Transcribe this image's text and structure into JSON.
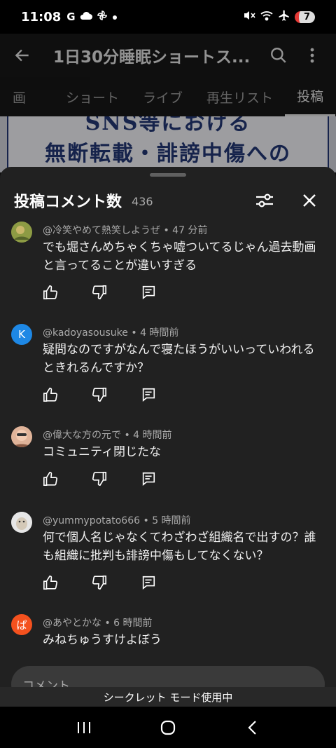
{
  "status_bar": {
    "time": "11:08",
    "left_icons": [
      "google-icon",
      "cloud-icon",
      "pinwheel-icon",
      "dot-icon"
    ],
    "right_icons": [
      "mute-icon",
      "wifi-icon",
      "airplane-icon"
    ],
    "battery": "7"
  },
  "app_bar": {
    "title": "1日30分睡眠ショートス..."
  },
  "tabs": [
    "画",
    "ショート",
    "ライブ",
    "再生リスト",
    "投稿"
  ],
  "active_tab": "投稿",
  "banner": {
    "line1": "SNS等における",
    "line2": "無断転載・誹謗中傷への"
  },
  "sheet": {
    "title": "投稿コメント数",
    "count": "436"
  },
  "comments": [
    {
      "author": "@冷笑やめて熱笑しようぜ",
      "time": "47 分前",
      "text": "でも堀さんめちゃくちゃ嘘ついてるじゃん過去動画と言ってることが違いすぎる",
      "avatar_letter": "",
      "avatar_color": "#7a8a3a"
    },
    {
      "author": "@kadoyasousuke",
      "time": "4 時間前",
      "text": "疑問なのですがなんで寝たほうがいいっていわれるときれるんですか？",
      "avatar_letter": "K",
      "avatar_color": "#1e88e5"
    },
    {
      "author": "@偉大な方の元で",
      "time": "4 時間前",
      "text": "コミュニティ閉じたな",
      "avatar_letter": "",
      "avatar_color": "#d9a58a"
    },
    {
      "author": "@yummypotato666",
      "time": "5 時間前",
      "text": "何で個人名じゃなくてわざわざ組織名で出すの？誰も組織に批判も誹謗中傷もしてなくない？",
      "avatar_letter": "",
      "avatar_color": "#cfcfcf"
    },
    {
      "author": "@あやとかな",
      "time": "6 時間前",
      "text": "みねちゅうすけよぼう",
      "avatar_letter": "ぱ",
      "avatar_color": "#f4511e"
    }
  ],
  "comment_input": {
    "placeholder": "コメント..."
  },
  "incognito_text": "シークレット モード使用中"
}
